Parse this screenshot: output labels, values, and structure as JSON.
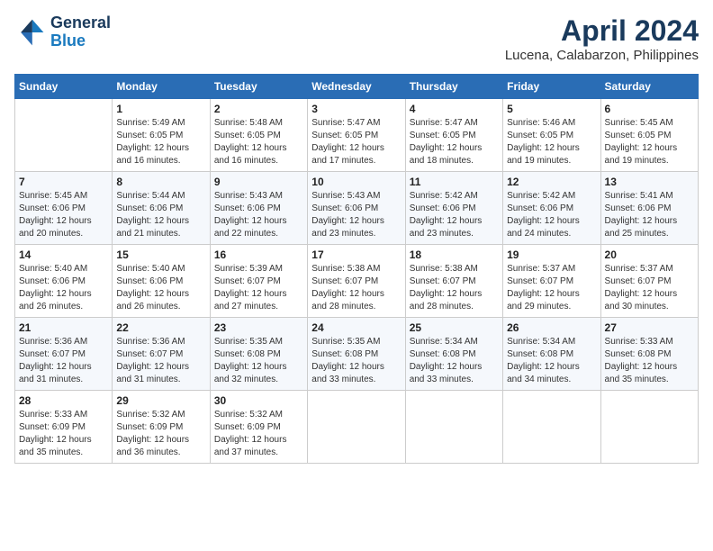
{
  "header": {
    "logo_line1": "General",
    "logo_line2": "Blue",
    "title": "April 2024",
    "subtitle": "Lucena, Calabarzon, Philippines"
  },
  "days_of_week": [
    "Sunday",
    "Monday",
    "Tuesday",
    "Wednesday",
    "Thursday",
    "Friday",
    "Saturday"
  ],
  "weeks": [
    [
      {
        "day": "",
        "info": ""
      },
      {
        "day": "1",
        "info": "Sunrise: 5:49 AM\nSunset: 6:05 PM\nDaylight: 12 hours\nand 16 minutes."
      },
      {
        "day": "2",
        "info": "Sunrise: 5:48 AM\nSunset: 6:05 PM\nDaylight: 12 hours\nand 16 minutes."
      },
      {
        "day": "3",
        "info": "Sunrise: 5:47 AM\nSunset: 6:05 PM\nDaylight: 12 hours\nand 17 minutes."
      },
      {
        "day": "4",
        "info": "Sunrise: 5:47 AM\nSunset: 6:05 PM\nDaylight: 12 hours\nand 18 minutes."
      },
      {
        "day": "5",
        "info": "Sunrise: 5:46 AM\nSunset: 6:05 PM\nDaylight: 12 hours\nand 19 minutes."
      },
      {
        "day": "6",
        "info": "Sunrise: 5:45 AM\nSunset: 6:05 PM\nDaylight: 12 hours\nand 19 minutes."
      }
    ],
    [
      {
        "day": "7",
        "info": "Sunrise: 5:45 AM\nSunset: 6:06 PM\nDaylight: 12 hours\nand 20 minutes."
      },
      {
        "day": "8",
        "info": "Sunrise: 5:44 AM\nSunset: 6:06 PM\nDaylight: 12 hours\nand 21 minutes."
      },
      {
        "day": "9",
        "info": "Sunrise: 5:43 AM\nSunset: 6:06 PM\nDaylight: 12 hours\nand 22 minutes."
      },
      {
        "day": "10",
        "info": "Sunrise: 5:43 AM\nSunset: 6:06 PM\nDaylight: 12 hours\nand 23 minutes."
      },
      {
        "day": "11",
        "info": "Sunrise: 5:42 AM\nSunset: 6:06 PM\nDaylight: 12 hours\nand 23 minutes."
      },
      {
        "day": "12",
        "info": "Sunrise: 5:42 AM\nSunset: 6:06 PM\nDaylight: 12 hours\nand 24 minutes."
      },
      {
        "day": "13",
        "info": "Sunrise: 5:41 AM\nSunset: 6:06 PM\nDaylight: 12 hours\nand 25 minutes."
      }
    ],
    [
      {
        "day": "14",
        "info": "Sunrise: 5:40 AM\nSunset: 6:06 PM\nDaylight: 12 hours\nand 26 minutes."
      },
      {
        "day": "15",
        "info": "Sunrise: 5:40 AM\nSunset: 6:06 PM\nDaylight: 12 hours\nand 26 minutes."
      },
      {
        "day": "16",
        "info": "Sunrise: 5:39 AM\nSunset: 6:07 PM\nDaylight: 12 hours\nand 27 minutes."
      },
      {
        "day": "17",
        "info": "Sunrise: 5:38 AM\nSunset: 6:07 PM\nDaylight: 12 hours\nand 28 minutes."
      },
      {
        "day": "18",
        "info": "Sunrise: 5:38 AM\nSunset: 6:07 PM\nDaylight: 12 hours\nand 28 minutes."
      },
      {
        "day": "19",
        "info": "Sunrise: 5:37 AM\nSunset: 6:07 PM\nDaylight: 12 hours\nand 29 minutes."
      },
      {
        "day": "20",
        "info": "Sunrise: 5:37 AM\nSunset: 6:07 PM\nDaylight: 12 hours\nand 30 minutes."
      }
    ],
    [
      {
        "day": "21",
        "info": "Sunrise: 5:36 AM\nSunset: 6:07 PM\nDaylight: 12 hours\nand 31 minutes."
      },
      {
        "day": "22",
        "info": "Sunrise: 5:36 AM\nSunset: 6:07 PM\nDaylight: 12 hours\nand 31 minutes."
      },
      {
        "day": "23",
        "info": "Sunrise: 5:35 AM\nSunset: 6:08 PM\nDaylight: 12 hours\nand 32 minutes."
      },
      {
        "day": "24",
        "info": "Sunrise: 5:35 AM\nSunset: 6:08 PM\nDaylight: 12 hours\nand 33 minutes."
      },
      {
        "day": "25",
        "info": "Sunrise: 5:34 AM\nSunset: 6:08 PM\nDaylight: 12 hours\nand 33 minutes."
      },
      {
        "day": "26",
        "info": "Sunrise: 5:34 AM\nSunset: 6:08 PM\nDaylight: 12 hours\nand 34 minutes."
      },
      {
        "day": "27",
        "info": "Sunrise: 5:33 AM\nSunset: 6:08 PM\nDaylight: 12 hours\nand 35 minutes."
      }
    ],
    [
      {
        "day": "28",
        "info": "Sunrise: 5:33 AM\nSunset: 6:09 PM\nDaylight: 12 hours\nand 35 minutes."
      },
      {
        "day": "29",
        "info": "Sunrise: 5:32 AM\nSunset: 6:09 PM\nDaylight: 12 hours\nand 36 minutes."
      },
      {
        "day": "30",
        "info": "Sunrise: 5:32 AM\nSunset: 6:09 PM\nDaylight: 12 hours\nand 37 minutes."
      },
      {
        "day": "",
        "info": ""
      },
      {
        "day": "",
        "info": ""
      },
      {
        "day": "",
        "info": ""
      },
      {
        "day": "",
        "info": ""
      }
    ]
  ]
}
